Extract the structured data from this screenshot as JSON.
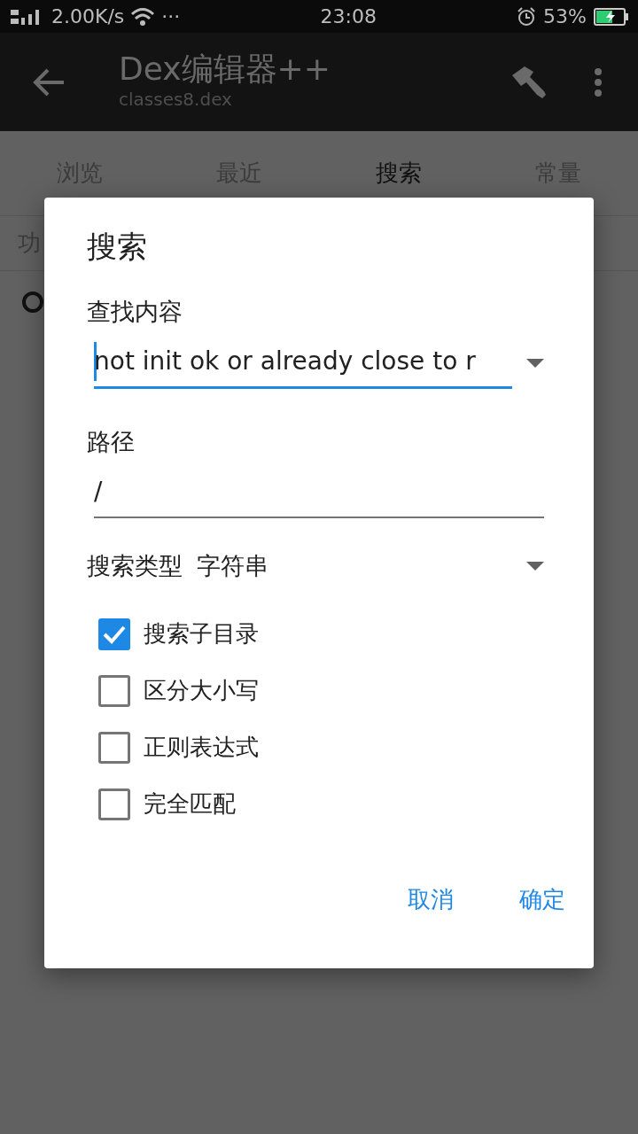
{
  "status_bar": {
    "speed": "2.00K/s",
    "more": "···",
    "time": "23:08",
    "battery": "53%"
  },
  "toolbar": {
    "title": "Dex编辑器++",
    "subtitle": "classes8.dex"
  },
  "tabs": [
    {
      "label": "浏览",
      "selected": false
    },
    {
      "label": "最近",
      "selected": false
    },
    {
      "label": "搜索",
      "selected": true
    },
    {
      "label": "常量",
      "selected": false
    }
  ],
  "partial_label": "功",
  "dialog": {
    "title": "搜索",
    "fields": [
      {
        "label": "查找内容",
        "value": "not init ok or already close to r",
        "focused": true,
        "dropdown": true
      },
      {
        "label": "路径",
        "value": "/",
        "focused": false,
        "dropdown": false
      }
    ],
    "type_label": "搜索类型",
    "type_value": "字符串",
    "options": [
      {
        "label": "搜索子目录",
        "checked": true
      },
      {
        "label": "区分大小写",
        "checked": false
      },
      {
        "label": "正则表达式",
        "checked": false
      },
      {
        "label": "完全匹配",
        "checked": false
      }
    ],
    "buttons": [
      "取消",
      "确定"
    ]
  }
}
